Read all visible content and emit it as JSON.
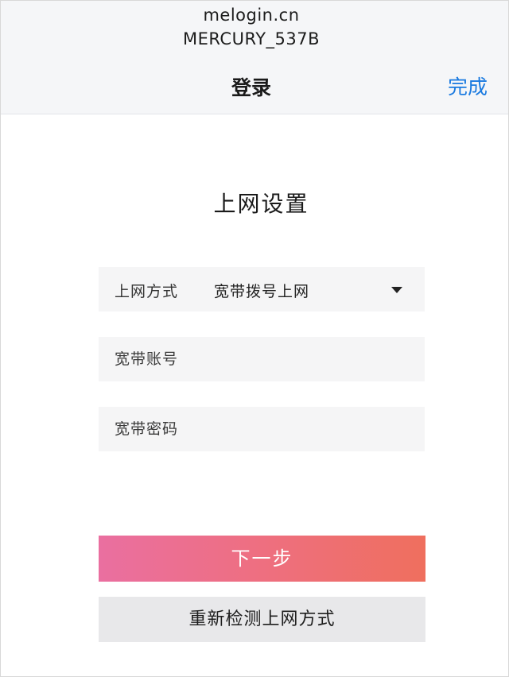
{
  "browser": {
    "host": "melogin.cn",
    "ssid": "MERCURY_537B"
  },
  "nav": {
    "title": "登录",
    "done_label": "完成"
  },
  "form": {
    "title": "上网设置",
    "method": {
      "label": "上网方式",
      "value": "宽带拨号上网"
    },
    "account": {
      "placeholder": "宽带账号"
    },
    "password": {
      "placeholder": "宽带密码"
    },
    "next_label": "下一步",
    "redetect_label": "重新检测上网方式"
  },
  "colors": {
    "accent_blue": "#1a7ae0",
    "gradient_start": "#ea6fa0",
    "gradient_end": "#ef6f5e"
  },
  "icons": {
    "method_dropdown": "caret-down-icon"
  }
}
